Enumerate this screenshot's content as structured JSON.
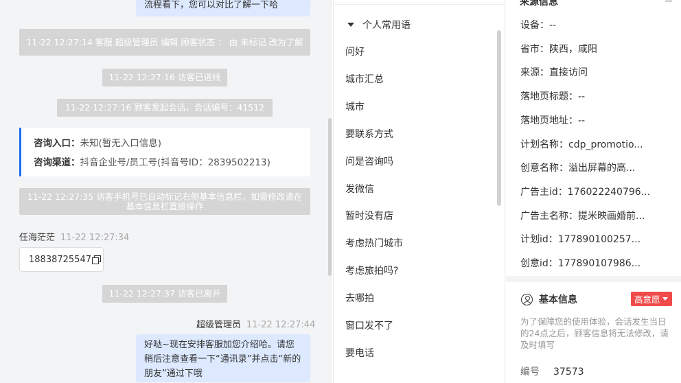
{
  "chat": {
    "top_bubble": "流程看下，您可以对比了解一下哈",
    "system_messages": [
      "11-22 12:27:14 客服 超级管理员 编辑 顾客状态 ： 由 未标记 改为了解",
      "11-22 12:27:16 访客已进线",
      "11-22 12:27:16 顾客发起会话，会话编号：41512",
      "11-22 12:27:35 访客手机号已自动标记右侧基本信息栏，如需修改请在基本信息栏直接操作",
      "11-22 12:27:37 访客已离开"
    ],
    "card": {
      "entry_label": "咨询入口：",
      "entry_value": "未知(暂无入口信息)",
      "channel_label": "咨询渠道：",
      "channel_value": "抖音企业号/员工号(抖音号ID：2839502213)"
    },
    "visitor": {
      "name": "任海茫茫",
      "time": "11-22 12:27:34",
      "phone": "18838725547"
    },
    "agent": {
      "name": "超级管理员",
      "time": "11-22 12:27:44",
      "message": "好哒~现在安排客服加您介绍哈。请您稍后注意查看一下“通讯录”并点击“新的朋友”通过下哦"
    }
  },
  "phrases": {
    "group_title": "个人常用语",
    "items": [
      "问好",
      "城市汇总",
      "城市",
      "要联系方式",
      "问是咨询吗",
      "发微信",
      "暂时没有店",
      "考虑热门城市",
      "考虑旅拍吗?",
      "去哪拍",
      "窗口发不了",
      "要电话"
    ]
  },
  "info": {
    "section_title": "来源信息",
    "rows": [
      {
        "label": "设备：",
        "value": "--"
      },
      {
        "label": "省市：",
        "value": "陕西，咸阳"
      },
      {
        "label": "来源：",
        "value": "直接访问"
      },
      {
        "label": "落地页标题：",
        "value": "--"
      },
      {
        "label": "落地页地址：",
        "value": "--"
      },
      {
        "label": "计划名称：",
        "value": "cdp_promotio..."
      },
      {
        "label": "创意名称：",
        "value": "溢出屏幕的高..."
      },
      {
        "label": "广告主id：",
        "value": "176022240796..."
      },
      {
        "label": "广告主名称：",
        "value": "提米映画婚前..."
      },
      {
        "label": "计划id：",
        "value": "177890100257..."
      },
      {
        "label": "创意id：",
        "value": "177890107986..."
      }
    ],
    "basic": {
      "title": "基本信息",
      "intent_badge": "高意愿",
      "note": "为了保障您的使用体验，会话发生当日的24点之后，顾客信息将无法修改，请及时填写",
      "id_label": "编号",
      "id_value": "37573"
    }
  }
}
